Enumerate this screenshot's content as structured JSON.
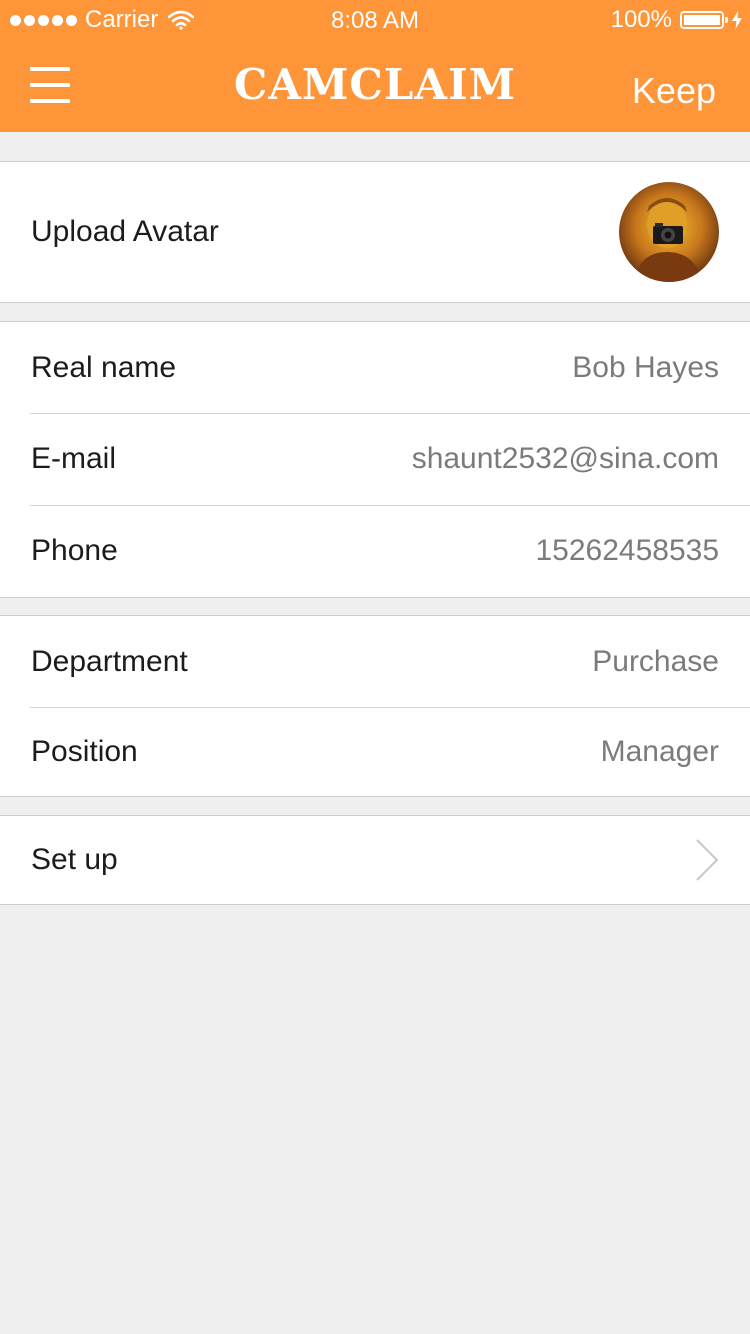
{
  "status_bar": {
    "carrier": "Carrier",
    "time": "8:08 AM",
    "battery": "100%",
    "battery_level": 1.0
  },
  "header": {
    "title": "CAMCLAIM",
    "keep_label": "Keep",
    "menu_icon": "hamburger-menu-icon"
  },
  "avatar": {
    "label": "Upload Avatar"
  },
  "profile": {
    "real_name_label": "Real name",
    "real_name": "Bob Hayes",
    "email_label": "E-mail",
    "email": "shaunt2532@sina.com",
    "phone_label": "Phone",
    "phone": "15262458535"
  },
  "work": {
    "department_label": "Department",
    "department": "Purchase",
    "position_label": "Position",
    "position": "Manager"
  },
  "settings": {
    "setup_label": "Set up"
  },
  "colors": {
    "accent": "#fe9538",
    "background": "#efefef",
    "value_text": "#7b7b7b"
  }
}
